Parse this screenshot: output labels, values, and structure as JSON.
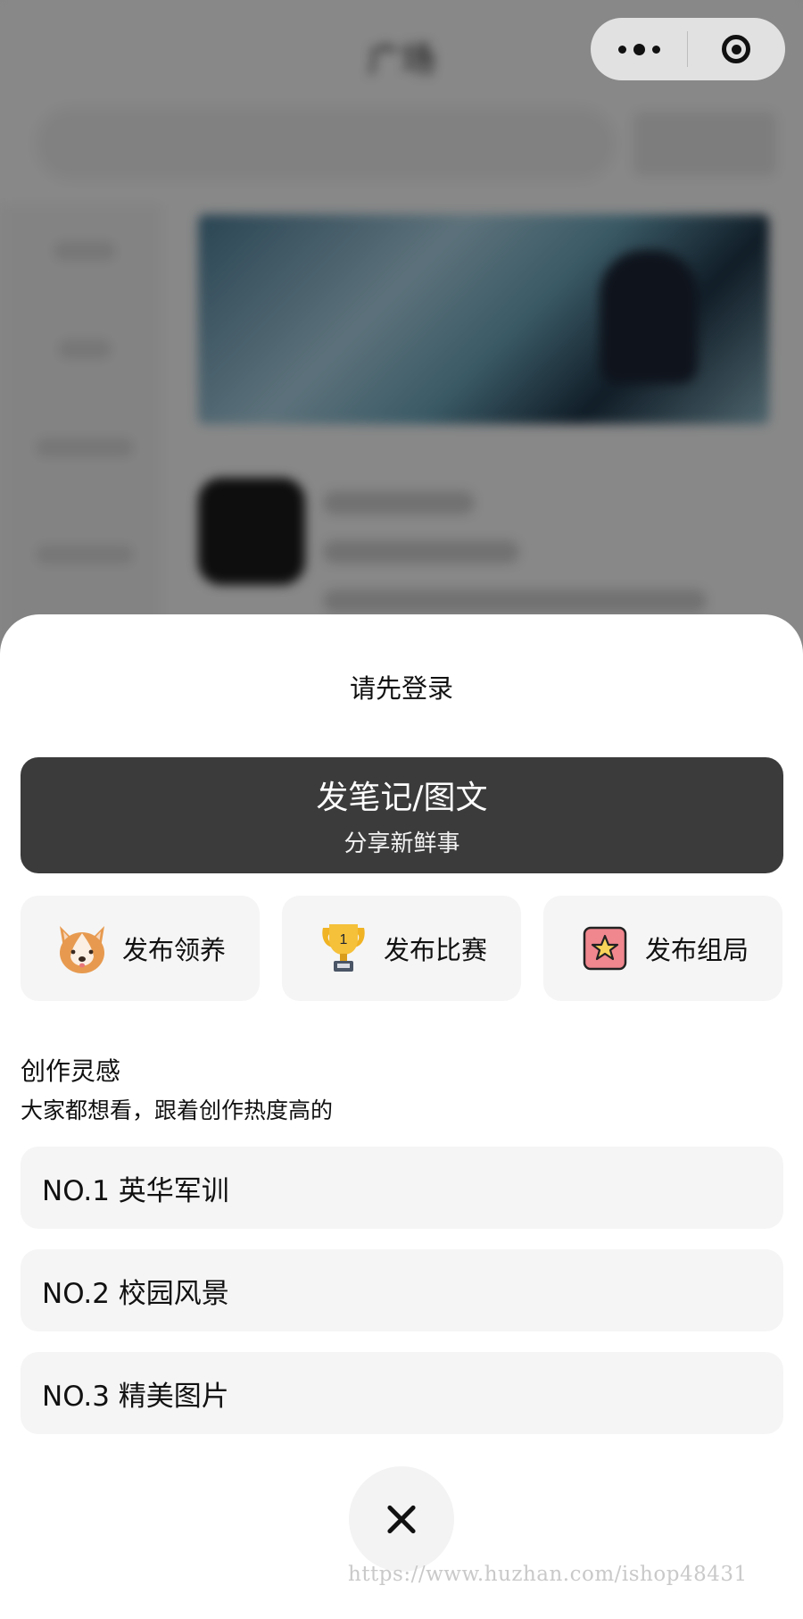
{
  "background_page": {
    "nav_title": "广场"
  },
  "sheet": {
    "title": "请先登录",
    "primary_action": {
      "label": "发笔记/图文",
      "sublabel": "分享新鲜事"
    },
    "quick_actions": [
      {
        "label": "发布领养",
        "icon": "corgi-dog-icon"
      },
      {
        "label": "发布比赛",
        "icon": "trophy-icon",
        "icon_text": "1"
      },
      {
        "label": "发布组局",
        "icon": "star-badge-icon"
      }
    ],
    "inspiration": {
      "title": "创作灵感",
      "subtitle": "大家都想看，跟着创作热度高的",
      "topics": [
        "NO.1 英华军训",
        "NO.2 校园风景",
        "NO.3 精美图片"
      ]
    },
    "close_icon": "close-icon"
  },
  "watermark": "https://www.huzhan.com/ishop48431",
  "colors": {
    "primary_button_bg": "#3b3b3b",
    "sheet_bg": "#ffffff",
    "card_bg": "#f5f5f5",
    "overlay": "rgba(0,0,0,0.45)"
  }
}
